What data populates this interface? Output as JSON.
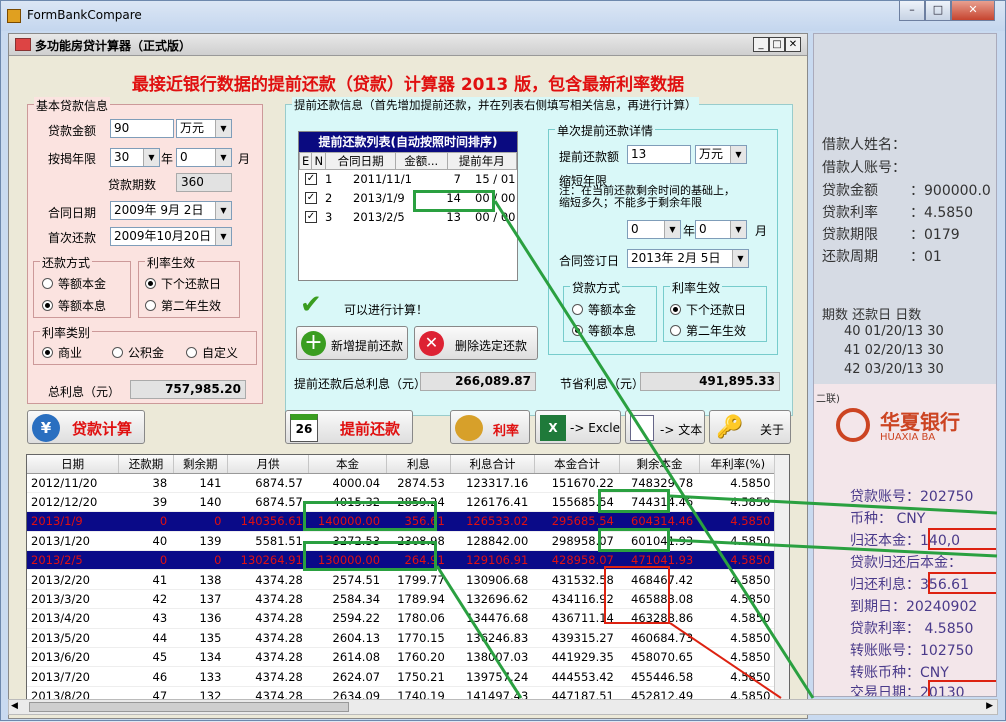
{
  "window": {
    "title": "FormBankCompare"
  },
  "app": {
    "title": "多功能房贷计算器（正式版）",
    "headline": "最接近银行数据的提前还款（贷款）计算器 2013 版，包含最新利率数据"
  },
  "basic": {
    "group": "基本贷款信息",
    "amount_label": "贷款金额",
    "amount": "90",
    "amount_unit": "万元",
    "term_label": "按揭年限",
    "years": "30",
    "year_unit": "年",
    "months": "0",
    "month_unit": "月",
    "periods_label": "贷款期数",
    "periods": "360",
    "contract_label": "合同日期",
    "contract_date": "2009年  9月  2日",
    "first_label": "首次还款",
    "first_date": "2009年10月20日",
    "repay_group": "还款方式",
    "repay_opt1": "等额本金",
    "repay_opt2": "等额本息",
    "rate_group": "利率生效",
    "rate_opt1": "下个还款日",
    "rate_opt2": "第二年生效",
    "ratetype_group": "利率类别",
    "rt1": "商业",
    "rt2": "公积金",
    "rt3": "自定义",
    "interest_label": "总利息（元）",
    "interest": "757,985.20"
  },
  "prepay": {
    "group": "提前还款信息（首先增加提前还款，并在列表右侧填写相关信息，再进行计算）",
    "list_title": "提前还款列表(自动按照时间排序)",
    "cols": [
      "E",
      "N",
      "合同日期",
      "金额...",
      "提前年月"
    ],
    "rows": [
      {
        "n": "1",
        "date": "2011/11/1",
        "amt": "7",
        "ym": "15 / 01"
      },
      {
        "n": "2",
        "date": "2013/1/9",
        "amt": "14",
        "ym": "00 / 00"
      },
      {
        "n": "3",
        "date": "2013/2/5",
        "amt": "13",
        "ym": "00 / 00"
      }
    ],
    "ok_text": "可以进行计算！",
    "add_btn": "新增提前还款",
    "del_btn": "删除选定还款",
    "after_label": "提前还款后总利息（元）",
    "after_value": "266,089.87",
    "save_label": "节省利息（元）",
    "save_value": "491,895.33"
  },
  "single": {
    "group": "单次提前还款详情",
    "amt_label": "提前还款额",
    "amt": "13",
    "amt_unit": "万元",
    "shorten_label": "缩短年限",
    "note1": "注：在当前还款剩余时间的基础上，",
    "note2": "缩短多久；不能多于剩余年限",
    "y": "0",
    "y_unit": "年",
    "m": "0",
    "m_unit": "月",
    "sign_label": "合同签订日",
    "sign_date": "2013年  2月  5日",
    "repay_group": "贷款方式",
    "ro1": "等额本金",
    "ro2": "等额本息",
    "rate_group": "利率生效",
    "rr1": "下个还款日",
    "rr2": "第二年生效"
  },
  "toolbar": {
    "calc": "贷款计算",
    "prepay": "提前还款",
    "rate": "利率",
    "excel": "-> Excle",
    "text": "-> 文本",
    "about": "关于"
  },
  "grid": {
    "cols": [
      "日期",
      "还款期",
      "剩余期",
      "月供",
      "本金",
      "利息",
      "利息合计",
      "本金合计",
      "剩余本金",
      "年利率(%)"
    ],
    "rows": [
      [
        "2012/11/20",
        "38",
        "141",
        "6874.57",
        "4000.04",
        "2874.53",
        "123317.16",
        "151670.22",
        "748329.78",
        "4.5850"
      ],
      [
        "2012/12/20",
        "39",
        "140",
        "6874.57",
        "4015.32",
        "2859.24",
        "126176.41",
        "155685.54",
        "744314.46",
        "4.5850"
      ],
      [
        "2013/1/9",
        "0",
        "0",
        "140356.61",
        "140000.00",
        "356.61",
        "126533.02",
        "295685.54",
        "604314.46",
        "4.5850"
      ],
      [
        "2013/1/20",
        "40",
        "139",
        "5581.51",
        "3272.53",
        "2308.98",
        "128842.00",
        "298958.07",
        "601041.93",
        "4.5850"
      ],
      [
        "2013/2/5",
        "0",
        "0",
        "130264.91",
        "130000.00",
        "264.91",
        "129106.91",
        "428958.07",
        "471041.93",
        "4.5850"
      ],
      [
        "2013/2/20",
        "41",
        "138",
        "4374.28",
        "2574.51",
        "1799.77",
        "130906.68",
        "431532.58",
        "468467.42",
        "4.5850"
      ],
      [
        "2013/3/20",
        "42",
        "137",
        "4374.28",
        "2584.34",
        "1789.94",
        "132696.62",
        "434116.92",
        "465883.08",
        "4.5850"
      ],
      [
        "2013/4/20",
        "43",
        "136",
        "4374.28",
        "2594.22",
        "1780.06",
        "134476.68",
        "436711.14",
        "463288.86",
        "4.5850"
      ],
      [
        "2013/5/20",
        "44",
        "135",
        "4374.28",
        "2604.13",
        "1770.15",
        "136246.83",
        "439315.27",
        "460684.73",
        "4.5850"
      ],
      [
        "2013/6/20",
        "45",
        "134",
        "4374.28",
        "2614.08",
        "1760.20",
        "138007.03",
        "441929.35",
        "458070.65",
        "4.5850"
      ],
      [
        "2013/7/20",
        "46",
        "133",
        "4374.28",
        "2624.07",
        "1750.21",
        "139757.24",
        "444553.42",
        "455446.58",
        "4.5850"
      ],
      [
        "2013/8/20",
        "47",
        "132",
        "4374.28",
        "2634.09",
        "1740.19",
        "141497.43",
        "447187.51",
        "452812.49",
        "4.5850"
      ]
    ],
    "highlight": [
      2,
      4
    ]
  },
  "doc": {
    "l1": "借款人姓名：",
    "l2": "借款人账号：",
    "l3": "贷款金额",
    "v3": "：900000.0",
    "l4": "贷款利率",
    "v4": "：4.5850",
    "l5": "贷款期限",
    "v5": "：0179",
    "l6": "还款周期",
    "v6": "：01",
    "h": "期数  还款日        日数",
    "r1": "40 01/20/13     30",
    "r2": "41 02/20/13     30",
    "r3": "42 03/20/13     30",
    "bank": "华夏银行",
    "bank_en": "HUAXIA BA",
    "tag": "二联)",
    "d1": "贷款账号：202750",
    "d2": "币种：  CNY",
    "d3": "归还本金：140,0",
    "d4": "贷款归还后本金：",
    "d5": "归还利息：356.61",
    "d6": "到期日：20240902",
    "d7": "贷款利率：  4.5850",
    "d8": "转账账号：102750",
    "d9": "转账币种：CNY",
    "d10": "交易日期：20130"
  }
}
